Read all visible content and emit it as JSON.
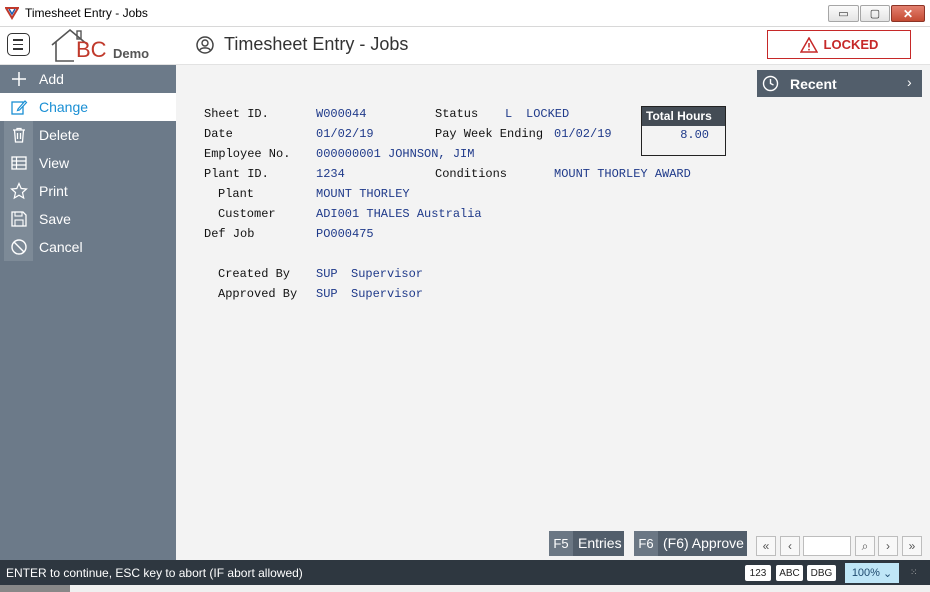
{
  "window": {
    "title": "Timesheet Entry - Jobs",
    "minimize_glyph": "▭",
    "maximize_glyph": "▢",
    "close_glyph": "✕"
  },
  "header": {
    "logo_letters": "BC",
    "logo_suffix": "Demo",
    "page_title": "Timesheet Entry - Jobs",
    "status_badge": "LOCKED"
  },
  "sidebar": {
    "items": [
      {
        "label": "Add",
        "icon": "plus-icon"
      },
      {
        "label": "Change",
        "icon": "pencil-icon"
      },
      {
        "label": "Delete",
        "icon": "trash-icon"
      },
      {
        "label": "View",
        "icon": "table-icon"
      },
      {
        "label": "Print",
        "icon": "star-icon"
      },
      {
        "label": "Save",
        "icon": "floppy-icon"
      },
      {
        "label": "Cancel",
        "icon": "cancel-icon"
      }
    ],
    "active": "Change"
  },
  "recent": {
    "label": "Recent",
    "chevron": "›"
  },
  "form": {
    "sheet_id_label": "Sheet ID.",
    "sheet_id": "W000044",
    "status_label": "Status",
    "status_code": "L",
    "status_text": "LOCKED",
    "date_label": "Date",
    "date": "01/02/19",
    "pay_week_label": "Pay Week Ending",
    "pay_week": "01/02/19",
    "employee_label": "Employee No.",
    "employee": "000000001 JOHNSON, JIM",
    "plant_id_label": "Plant ID.",
    "plant_id": "1234",
    "conditions_label": "Conditions",
    "conditions": "MOUNT THORLEY AWARD",
    "plant_label": "Plant",
    "plant": "MOUNT THORLEY",
    "customer_label": "Customer",
    "customer": "ADI001 THALES Australia",
    "def_job_label": "Def Job",
    "def_job": "PO000475",
    "created_by_label": "Created By",
    "created_by_code": "SUP",
    "created_by_name": "Supervisor",
    "approved_by_label": "Approved By",
    "approved_by_code": "SUP",
    "approved_by_name": "Supervisor"
  },
  "total_hours": {
    "label": "Total Hours",
    "value": "8.00"
  },
  "buttons": {
    "entries_key": "F5",
    "entries_label": "Entries",
    "approve_key": "F6",
    "approve_label": "(F6) Approve"
  },
  "pager": {
    "first": "«",
    "prev": "‹",
    "search": "⌕",
    "next": "›",
    "last": "»"
  },
  "statusbar": {
    "message": "ENTER to continue, ESC key to abort (IF abort allowed)",
    "badge_num": "123",
    "badge_abc": "ABC",
    "badge_dbg": "DBG",
    "zoom": "100%"
  },
  "colors": {
    "sidebar": "#6c7a89",
    "accent": "#1a8fd4",
    "locked": "#c62828",
    "statusbar": "#2e3740"
  }
}
